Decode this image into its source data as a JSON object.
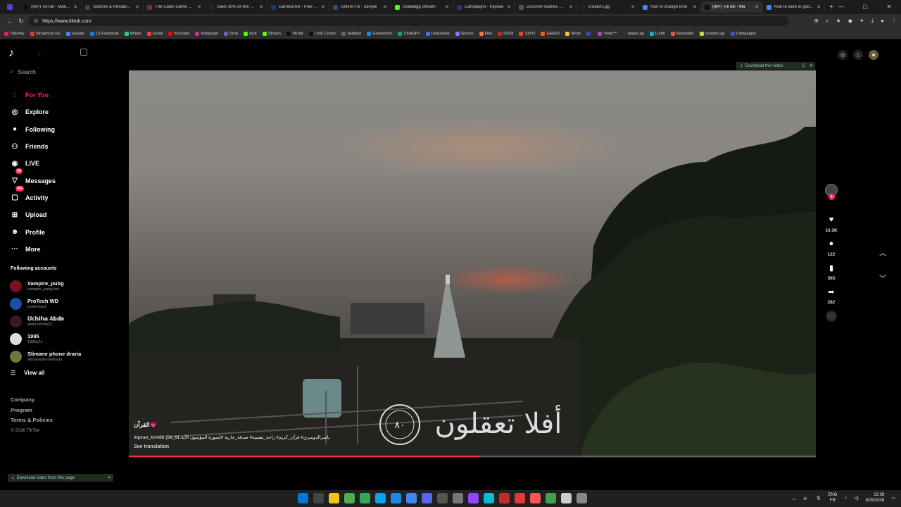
{
  "browser": {
    "tabs": [
      {
        "title": "(99+) TikTok - Make Yo",
        "color": "#111111",
        "active": false
      },
      {
        "title": "Skidrow & Reloaded G",
        "color": "#444444",
        "active": false
      },
      {
        "title": "The Cabin Game Early",
        "color": "#7a2e2e",
        "active": false
      },
      {
        "title": "Save 30% on the cab",
        "color": "#1b2838",
        "active": false
      },
      {
        "title": "GameDrive - Free Do",
        "color": "#1e3a5f",
        "active": false
      },
      {
        "title": "Online-Fix - Зачуск",
        "color": "#2a4b7c",
        "active": false
      },
      {
        "title": "chaballgg Stream",
        "color": "#53fc18",
        "active": false
      },
      {
        "title": "Campaigns - Klipeak",
        "color": "#333366",
        "active": false
      },
      {
        "title": "Discover Games with",
        "color": "#555555",
        "active": false
      },
      {
        "title": "creators.gg",
        "color": "#222222",
        "active": false
      },
      {
        "title": "how to change time",
        "color": "#4285f4",
        "active": false
      },
      {
        "title": "(99+) TikTok - Ma",
        "color": "#111111",
        "active": true
      },
      {
        "title": "how to save in god of",
        "color": "#4285f4",
        "active": false
      }
    ],
    "url": "https://www.tiktok.com",
    "bookmarks": [
      {
        "label": "TikFinity",
        "color": "#e91e63"
      },
      {
        "label": "Streamrun Go",
        "color": "#e53935"
      },
      {
        "label": "Google",
        "color": "#4285f4"
      },
      {
        "label": "(1) Facebook",
        "color": "#1877f2"
      },
      {
        "label": "Whats",
        "color": "#25d366"
      },
      {
        "label": "Gmail",
        "color": "#ea4335"
      },
      {
        "label": "YouTube",
        "color": "#ff0000"
      },
      {
        "label": "Instagram",
        "color": "#c13584"
      },
      {
        "label": "Drop",
        "color": "#7e57c2"
      },
      {
        "label": "Kick",
        "color": "#53fc18"
      },
      {
        "label": "Stream",
        "color": "#53fc18"
      },
      {
        "label": "TikTok",
        "color": "#111111"
      },
      {
        "label": "LIVE Center",
        "color": "#111111"
      },
      {
        "label": "Skidrow",
        "color": "#666666"
      },
      {
        "label": "GameDrive",
        "color": "#1e88e5"
      },
      {
        "label": "ChatGPT",
        "color": "#10a37f"
      },
      {
        "label": "DeepSeek",
        "color": "#4d6bfe"
      },
      {
        "label": "Gemini",
        "color": "#8e75ff"
      },
      {
        "label": "FitG",
        "color": "#ff7043"
      },
      {
        "label": "DODI",
        "color": "#c62828"
      },
      {
        "label": "1337x",
        "color": "#f44336"
      },
      {
        "label": "GEEKZ",
        "color": "#ff5722"
      },
      {
        "label": "Mods",
        "color": "#fbc02d"
      },
      {
        "label": "",
        "color": "#3949ab"
      },
      {
        "label": "Yamil™",
        "color": "#ab47bc"
      },
      {
        "label": "player.gg",
        "color": "#263238"
      },
      {
        "label": "Lurkit",
        "color": "#00bcd4"
      },
      {
        "label": "Keymailer",
        "color": "#ef5350"
      },
      {
        "label": "creators.gg",
        "color": "#cddc39"
      },
      {
        "label": "Campaigns",
        "color": "#3f51b5"
      }
    ]
  },
  "sidebar": {
    "search_placeholder": "Search",
    "nav": [
      {
        "label": "For You",
        "icon": "home-icon",
        "glyph": "⌂",
        "active": true,
        "badge": ""
      },
      {
        "label": "Explore",
        "icon": "compass-icon",
        "glyph": "◎",
        "active": false,
        "badge": ""
      },
      {
        "label": "Following",
        "icon": "following-avatar-icon",
        "glyph": "●",
        "active": false,
        "badge": ""
      },
      {
        "label": "Friends",
        "icon": "friends-icon",
        "glyph": "⚇",
        "active": false,
        "badge": ""
      },
      {
        "label": "LIVE",
        "icon": "live-icon",
        "glyph": "◉",
        "active": false,
        "badge": ""
      },
      {
        "label": "Messages",
        "icon": "messages-icon",
        "glyph": "▽",
        "active": false,
        "badge": "99"
      },
      {
        "label": "Activity",
        "icon": "activity-icon",
        "glyph": "▢",
        "active": false,
        "badge": "99+"
      },
      {
        "label": "Upload",
        "icon": "upload-icon",
        "glyph": "⊞",
        "active": false,
        "badge": ""
      },
      {
        "label": "Profile",
        "icon": "profile-icon",
        "glyph": "☻",
        "active": false,
        "badge": ""
      },
      {
        "label": "More",
        "icon": "more-icon",
        "glyph": "···",
        "active": false,
        "badge": ""
      }
    ],
    "following_title": "Following accounts",
    "accounts": [
      {
        "name": "Vampire_pubg",
        "handle": "vampire_pubg.live",
        "color": "#7a1020"
      },
      {
        "name": "ProTech WD",
        "handle": "protechwd",
        "color": "#1e4fa8"
      },
      {
        "name": "𝕌𝕔𝕙𝕚𝕙𝕒 𝔸𝕓𝕕𝕠",
        "handle": "abdouchiha22",
        "color": "#3a1a1a"
      },
      {
        "name": "1995",
        "handle": "1995q7x",
        "color": "#dddddd"
      },
      {
        "name": "Slimane phone draria",
        "handle": "slimanephonedraria",
        "color": "#6b7a3a"
      }
    ],
    "view_all": "View all",
    "footer": {
      "company": "Company",
      "program": "Program",
      "terms": "Terms & Policies",
      "copyright": "© 2026 TikTok"
    }
  },
  "video": {
    "download_banner": "Download this video",
    "download_banner_count": "2",
    "caption_title": "القرآن💗",
    "caption_desc": "#quran_krim86 {98_61.سورة المؤمنون الآية}# ياسرالدوسري# قرآن_كريم# راحة_نفسية# صدقة_جارية",
    "see_translation": "See translation",
    "overlay_text": "أفلا تعقلون",
    "overlay_number": "٨٠",
    "progress": 0.51
  },
  "actions": {
    "likes": "10.3K",
    "comments": "122",
    "saves": "565",
    "shares": "282"
  },
  "bottom_banner": "Download video from this page",
  "taskbar": {
    "lang_top": "ENG",
    "lang_bottom": "FR",
    "time": "22:38",
    "date": "8/29/2026",
    "apps": [
      "#0078d4",
      "#444444",
      "#f0c419",
      "#4caf50",
      "#34a853",
      "#00a4ef",
      "#1e88e5",
      "#4285f4",
      "#5865f2",
      "#555555",
      "#777777",
      "#9146ff",
      "#00bcd4",
      "#c62828",
      "#e53935",
      "#ff5252",
      "#43a047",
      "#cccccc",
      "#888888"
    ]
  }
}
